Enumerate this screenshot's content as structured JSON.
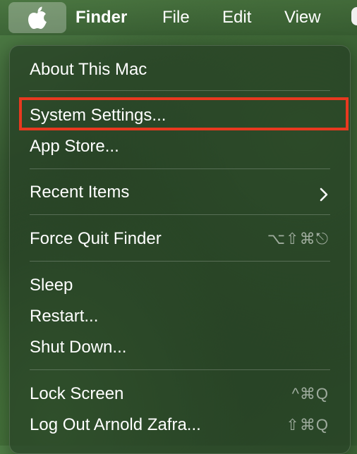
{
  "menubar": {
    "apple_icon": "apple-logo-icon",
    "items": [
      {
        "label": "Finder"
      },
      {
        "label": "File"
      },
      {
        "label": "Edit"
      },
      {
        "label": "View"
      }
    ]
  },
  "menu": {
    "items": [
      {
        "label": "About This Mac"
      },
      {
        "label": "System Settings..."
      },
      {
        "label": "App Store..."
      },
      {
        "label": "Recent Items",
        "has_submenu": true
      },
      {
        "label": "Force Quit Finder",
        "shortcut": "⌥⇧⌘⎋"
      },
      {
        "label": "Sleep"
      },
      {
        "label": "Restart..."
      },
      {
        "label": "Shut Down..."
      },
      {
        "label": "Lock Screen",
        "shortcut": "^⌘Q"
      },
      {
        "label": "Log Out Arnold Zafra...",
        "shortcut": "⇧⌘Q"
      }
    ]
  },
  "annotation": {
    "highlighted_item": "System Settings...",
    "color": "#e8391f"
  }
}
